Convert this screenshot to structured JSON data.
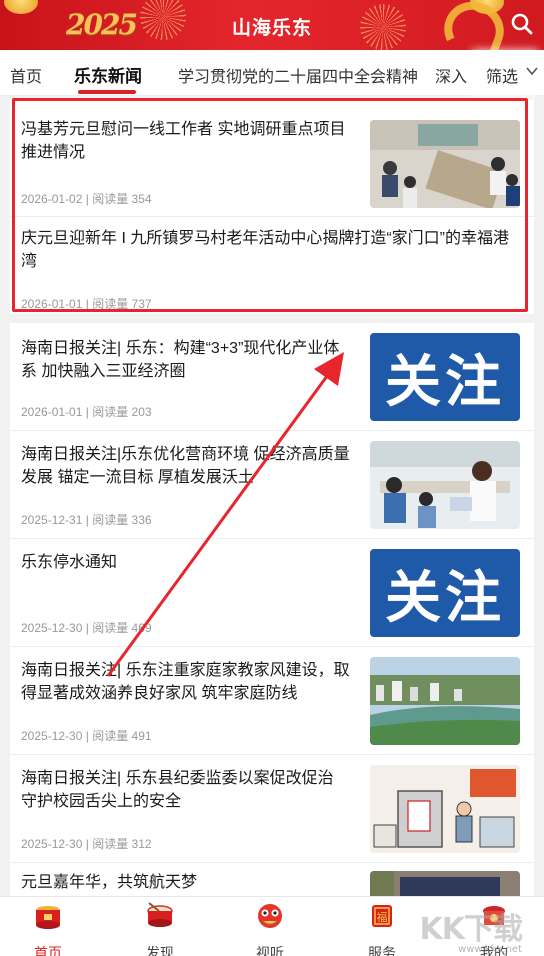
{
  "header": {
    "title": "山海乐东",
    "deco_year": "2025",
    "search_icon": "search-icon"
  },
  "tabs": [
    {
      "label": "首页",
      "active": false
    },
    {
      "label": "乐东新闻",
      "active": true
    },
    {
      "label": "学习贯彻党的二十届四中全会精神",
      "active": false
    },
    {
      "label": "深入",
      "active": false
    }
  ],
  "filter": {
    "label": "筛选",
    "icon": "chevron-down-icon"
  },
  "articles": [
    {
      "title": "冯基芳元旦慰问一线工作者 实地调研重点项目推进情况",
      "date": "2026-01-02",
      "reads_label": "阅读量",
      "reads": "354",
      "thumb": "meeting-photo"
    },
    {
      "title": "庆元旦迎新年 I 九所镇罗马村老年活动中心揭牌打造“家门口”的幸福港湾",
      "date": "2026-01-01",
      "reads_label": "阅读量",
      "reads": "737",
      "thumb": ""
    },
    {
      "title": "海南日报关注| 乐东：构建“3+3”现代化产业体系 加快融入三亚经济圈",
      "date": "2026-01-01",
      "reads_label": "阅读量",
      "reads": "203",
      "thumb": "关注"
    },
    {
      "title": "海南日报关注|乐东优化营商环境 促经济高质量发展 锚定一流目标 厚植发展沃土",
      "date": "2025-12-31",
      "reads_label": "阅读量",
      "reads": "336",
      "thumb": "service-hall-photo"
    },
    {
      "title": "乐东停水通知",
      "date": "2025-12-30",
      "reads_label": "阅读量",
      "reads": "469",
      "thumb": "关注"
    },
    {
      "title": "海南日报关注| 乐东注重家庭家教家风建设，取得显著成效涵养良好家风 筑牢家庭防线",
      "date": "2025-12-30",
      "reads_label": "阅读量",
      "reads": "491",
      "thumb": "city-aerial-photo"
    },
    {
      "title": "海南日报关注| 乐东县纪委监委以案促改促治 守护校园舌尖上的安全",
      "date": "2025-12-30",
      "reads_label": "阅读量",
      "reads": "312",
      "thumb": "cartoon-illustration"
    },
    {
      "title": "元旦嘉年华，共筑航天梦",
      "date": "",
      "reads_label": "",
      "reads": "",
      "thumb": "event-photo"
    }
  ],
  "bottom_nav": [
    {
      "label": "首页",
      "icon": "home-drum-icon",
      "active": true
    },
    {
      "label": "发现",
      "icon": "discover-drum-icon",
      "active": false
    },
    {
      "label": "视听",
      "icon": "lion-dance-icon",
      "active": false
    },
    {
      "label": "服务",
      "icon": "fu-lantern-icon",
      "active": false
    },
    {
      "label": "我的",
      "icon": "profile-icon",
      "active": false
    }
  ],
  "watermark": {
    "text": "KK下载",
    "sub": "www.kkx.net"
  },
  "colors": {
    "brand_red": "#e02020",
    "header_red": "#d01a20",
    "highlight": "#e8252c",
    "guanzhu_blue": "#1e5aa8"
  }
}
